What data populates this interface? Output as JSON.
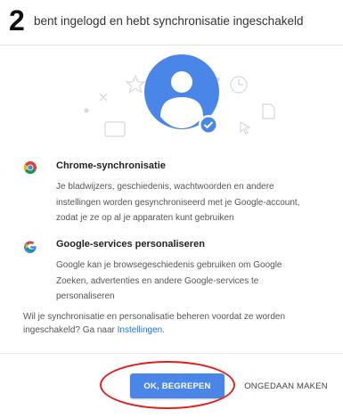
{
  "annotation": {
    "step_number": "2",
    "highlight_color": "#e0201b"
  },
  "header": {
    "title": "bent ingelogd en hebt synchronisatie ingeschakeld"
  },
  "illustration": {
    "icon": "account-avatar-icon",
    "badge_icon": "check-badge-icon",
    "accent": "#4a86e8"
  },
  "sections": [
    {
      "icon": "chrome-icon",
      "title": "Chrome-synchronisatie",
      "lines": [
        "Je bladwijzers, geschiedenis, wachtwoorden en andere",
        "instellingen worden gesynchroniseerd met je Google-account,",
        "zodat je ze op al je apparaten kunt gebruiken"
      ]
    },
    {
      "icon": "google-g-icon",
      "title": "Google-services personaliseren",
      "lines": [
        "Google kan je browsegeschiedenis gebruiken om Google",
        "Zoeken, advertenties en andere Google-services te",
        "personaliseren"
      ]
    }
  ],
  "sync_note": {
    "line1": "Wil je synchronisatie en personalisatie beheren voordat ze worden",
    "line2_prefix": "ingeschakeld? Ga naar ",
    "link": "Instellingen",
    "line2_suffix": "."
  },
  "buttons": {
    "ok_label": "OK, BEGREPEN",
    "undo_label": "ONGEDAAN MAKEN"
  }
}
